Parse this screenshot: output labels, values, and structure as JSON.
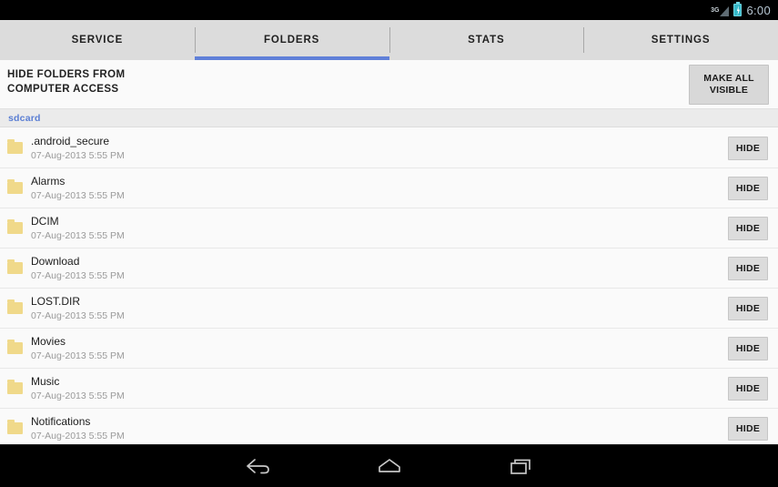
{
  "status_bar": {
    "network_label": "3G",
    "signal_icon": "signal-triangle-icon",
    "battery_icon": "battery-charging-icon",
    "time": "6:00"
  },
  "tabs": [
    {
      "label": "SERVICE",
      "active": false
    },
    {
      "label": "FOLDERS",
      "active": true
    },
    {
      "label": "STATS",
      "active": false
    },
    {
      "label": "SETTINGS",
      "active": false
    }
  ],
  "header": {
    "title_line1": "HIDE FOLDERS FROM",
    "title_line2": "COMPUTER ACCESS",
    "make_all_visible_line1": "MAKE ALL",
    "make_all_visible_line2": "VISIBLE"
  },
  "section": {
    "label": "sdcard"
  },
  "list": {
    "hide_label": "HIDE",
    "rows": [
      {
        "name": ".android_secure",
        "date": "07-Aug-2013 5:55 PM",
        "icon": "folder-icon"
      },
      {
        "name": "Alarms",
        "date": "07-Aug-2013 5:55 PM",
        "icon": "folder-icon"
      },
      {
        "name": "DCIM",
        "date": "07-Aug-2013 5:55 PM",
        "icon": "folder-icon"
      },
      {
        "name": "Download",
        "date": "07-Aug-2013 5:55 PM",
        "icon": "folder-icon"
      },
      {
        "name": "LOST.DIR",
        "date": "07-Aug-2013 5:55 PM",
        "icon": "folder-icon"
      },
      {
        "name": "Movies",
        "date": "07-Aug-2013 5:55 PM",
        "icon": "folder-icon"
      },
      {
        "name": "Music",
        "date": "07-Aug-2013 5:55 PM",
        "icon": "folder-icon"
      },
      {
        "name": "Notifications",
        "date": "07-Aug-2013 5:55 PM",
        "icon": "folder-icon"
      }
    ]
  },
  "navbar": {
    "back_icon": "back-arrow-icon",
    "home_icon": "home-icon",
    "recents_icon": "recent-apps-icon"
  },
  "colors": {
    "accent_blue": "#6080d8",
    "section_blue": "#5b7fd4",
    "folder_yellow": "#f0d98a",
    "tabbar_gray": "#dcdcdc",
    "battery_teal": "#35b8c8"
  }
}
